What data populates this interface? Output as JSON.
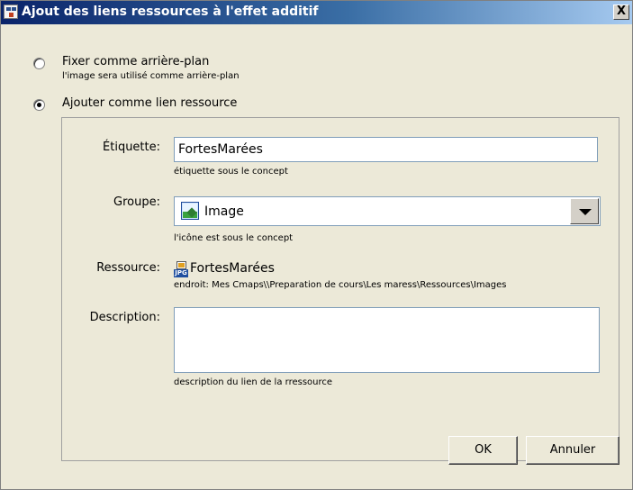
{
  "window": {
    "title": "Ajout des liens ressources à l'effet additif",
    "close_glyph": "X"
  },
  "options": {
    "background": {
      "label": "Fixer comme arrière-plan",
      "sublabel": "l'image sera utilisé comme arrière-plan",
      "selected": false
    },
    "resource_link": {
      "label": "Ajouter comme lien ressource",
      "selected": true
    }
  },
  "form": {
    "label_field": {
      "label": "Étiquette:",
      "value": "FortesMarées",
      "hint": "étiquette sous le concept"
    },
    "group_field": {
      "label": "Groupe:",
      "value": "Image",
      "icon": "image-icon",
      "hint": "l'icône est sous le concept"
    },
    "resource_field": {
      "label": "Ressource:",
      "icon": "jpg-file-icon",
      "icon_text": "JPG",
      "value": "FortesMarées",
      "location": "endroit: Mes Cmaps\\\\Preparation de cours\\Les maress\\Ressources\\Images"
    },
    "description_field": {
      "label": "Description:",
      "value": "",
      "hint": "description du lien de la rressource"
    }
  },
  "buttons": {
    "ok": "OK",
    "cancel": "Annuler"
  }
}
